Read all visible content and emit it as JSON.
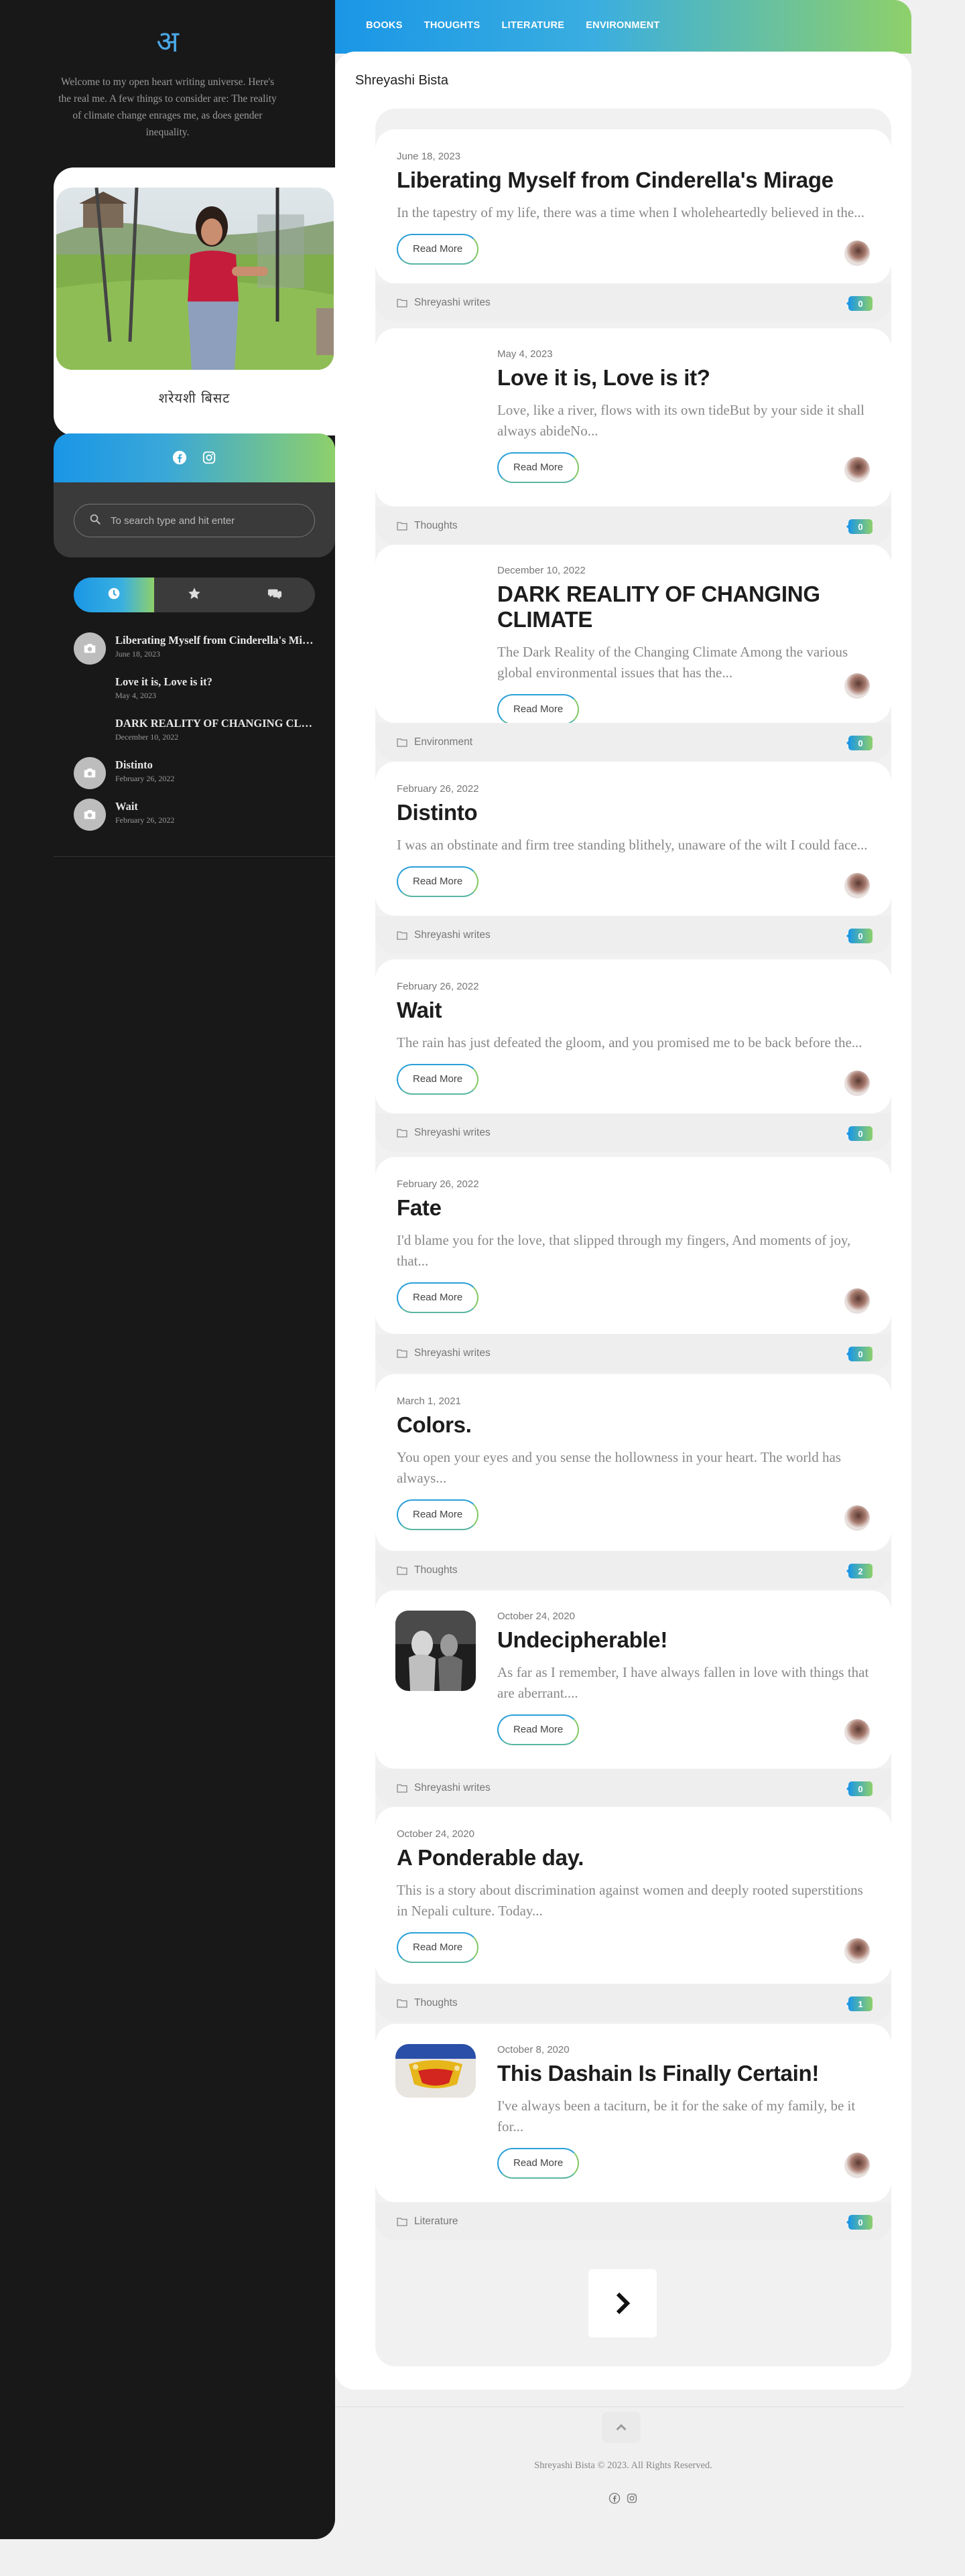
{
  "sidebar": {
    "logo_glyph": "अ",
    "welcome": "Welcome to my open heart writing universe. Here's the real me. A few things to consider are: The reality of climate change enrages me, as does gender inequality.",
    "profile_name": "शरेयशी बिसट",
    "search_placeholder": "To search type and hit enter",
    "tabs": [
      {
        "icon": "clock-icon",
        "active": true
      },
      {
        "icon": "star-icon",
        "active": false
      },
      {
        "icon": "comments-icon",
        "active": false
      }
    ],
    "recent": [
      {
        "title": "Liberating Myself from Cinderella's Mirage",
        "date": "June 18, 2023",
        "thumb": true
      },
      {
        "title": "Love it is, Love is it?",
        "date": "May 4, 2023",
        "thumb": false
      },
      {
        "title": "DARK REALITY OF CHANGING CLIMATE",
        "date": "December 10, 2022",
        "thumb": false
      },
      {
        "title": "Distinto",
        "date": "February 26, 2022",
        "thumb": true
      },
      {
        "title": "Wait",
        "date": "February 26, 2022",
        "thumb": true
      }
    ]
  },
  "nav": {
    "items": [
      "BOOKS",
      "THOUGHTS",
      "LITERATURE",
      "ENVIRONMENT"
    ]
  },
  "main": {
    "author": "Shreyashi Bista",
    "read_more_label": "Read More",
    "posts": [
      {
        "date": "June 18, 2023",
        "title": "Liberating Myself from Cinderella's Mirage",
        "excerpt": "In the tapestry of my life, there was a time when I wholeheartedly believed in the...",
        "category": "Shreyashi writes",
        "comments": "0"
      },
      {
        "date": "May 4, 2023",
        "title": "Love it is, Love is it?",
        "excerpt": "Love, like a river, flows with its own tideBut by your side it shall always abideNo...",
        "category": "Thoughts",
        "comments": "0"
      },
      {
        "date": "December 10, 2022",
        "title": "DARK REALITY OF CHANGING CLIMATE",
        "excerpt": "The Dark Reality of the Changing Climate Among the various global environmental issues that has the...",
        "category": "Environment",
        "comments": "0"
      },
      {
        "date": "February 26, 2022",
        "title": "Distinto",
        "excerpt": "I was an obstinate and firm tree standing blithely, unaware of the wilt I could face...",
        "category": "Shreyashi writes",
        "comments": "0"
      },
      {
        "date": "February 26, 2022",
        "title": "Wait",
        "excerpt": "The rain has just defeated the gloom, and you promised me to be back before the...",
        "category": "Shreyashi writes",
        "comments": "0"
      },
      {
        "date": "February 26, 2022",
        "title": "Fate",
        "excerpt": "I'd blame you for the love, that slipped through my fingers, And moments of joy, that...",
        "category": "Shreyashi writes",
        "comments": "0"
      },
      {
        "date": "March 1, 2021",
        "title": "Colors.",
        "excerpt": "You open your eyes and you sense the hollowness in your heart. The world has always...",
        "category": "Thoughts",
        "comments": "2"
      },
      {
        "date": "October 24, 2020",
        "title": "Undecipherable!",
        "excerpt": "As far as I remember, I have always fallen in love with things that are aberrant....",
        "category": "Shreyashi writes",
        "comments": "0"
      },
      {
        "date": "October 24, 2020",
        "title": "A Ponderable day.",
        "excerpt": "This is a story about discrimination against women and deeply rooted superstitions in Nepali culture. Today...",
        "category": "Thoughts",
        "comments": "1"
      },
      {
        "date": "October 8, 2020",
        "title": "This Dashain Is Finally Certain!",
        "excerpt": "I've always been a taciturn, be it for the sake of my family, be it for...",
        "category": "Literature",
        "comments": "0"
      }
    ]
  },
  "footer": {
    "copyright": "Shreyashi Bista © 2023. All Rights Reserved."
  }
}
